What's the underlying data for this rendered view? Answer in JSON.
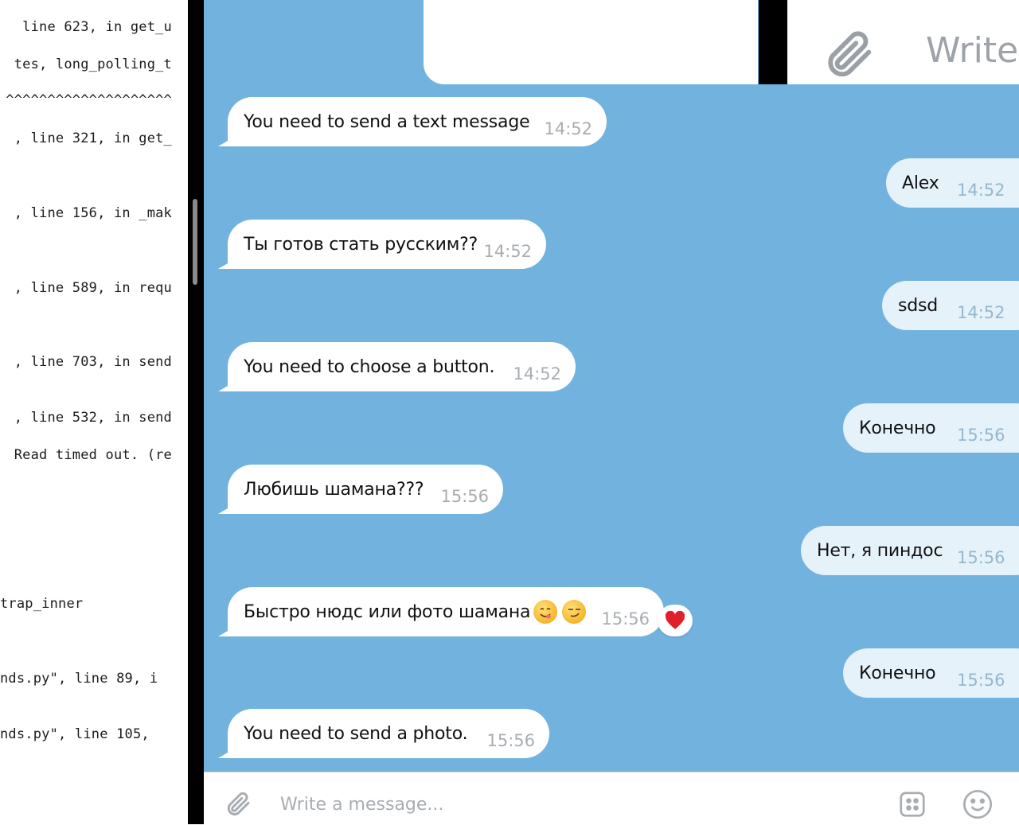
{
  "terminal": {
    "lines": [
      " line 623, in get_u",
      "tes, long_polling_t",
      "^^^^^^^^^^^^^^^^^^^^",
      ", line 321, in get_",
      ", line 156, in _mak",
      ", line 589, in requ",
      ", line 703, in send",
      ", line 532, in send",
      "Read timed out. (re",
      "trap_inner",
      "nds.py\", line 89, i",
      "nds.py\", line 105,"
    ]
  },
  "chat_top": {
    "write_text": "Write a"
  },
  "messages": [
    {
      "dir": "in",
      "text": "You need to send a text message",
      "time": "14:52"
    },
    {
      "dir": "out",
      "text": "Alex",
      "time": "14:52"
    },
    {
      "dir": "in",
      "text": "Ты готов стать русским??",
      "time": "14:52"
    },
    {
      "dir": "out",
      "text": "sdsd",
      "time": "14:52"
    },
    {
      "dir": "in",
      "text": "You need to choose a button.",
      "time": "14:52"
    },
    {
      "dir": "out",
      "text": "Конечно",
      "time": "15:56"
    },
    {
      "dir": "in",
      "text": "Любишь шамана???",
      "time": "15:56"
    },
    {
      "dir": "out",
      "text": "Нет, я пиндос",
      "time": "15:56"
    },
    {
      "dir": "in",
      "text": "Быстро нюдс или фото шамана",
      "time": "15:56",
      "emojis": [
        "yum-face-icon",
        "smirk-face-icon"
      ],
      "reaction": "heart-icon"
    },
    {
      "dir": "out",
      "text": "Конечно",
      "time": "15:56"
    },
    {
      "dir": "in",
      "text": "You need to send a photo.",
      "time": "15:56"
    }
  ],
  "input": {
    "placeholder": "Write a message..."
  },
  "colors": {
    "chat_bg": "#72b2de",
    "bubble_in": "#ffffff",
    "bubble_out": "#e6f2fa",
    "reaction_heart": "#e0202a"
  }
}
